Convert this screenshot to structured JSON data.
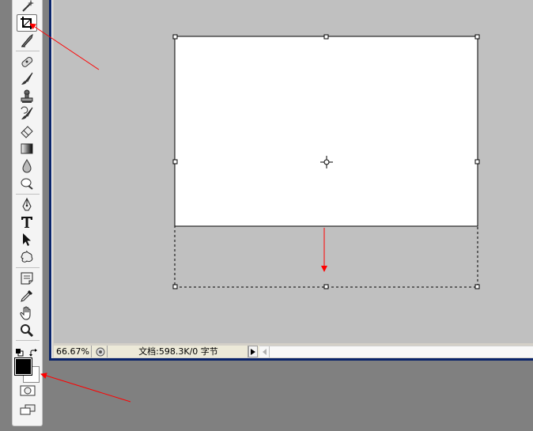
{
  "status_bar": {
    "zoom": "66.67%",
    "doc_info": "文档:598.3K/0 字节"
  },
  "toolbox": {
    "tools": [
      "magic-wand-icon",
      "crop-icon",
      "slice-icon",
      "healing-brush-icon",
      "brush-icon",
      "clone-stamp-icon",
      "history-brush-icon",
      "eraser-icon",
      "gradient-icon",
      "blur-icon",
      "dodge-icon",
      "pen-icon",
      "type-icon",
      "path-selection-icon",
      "custom-shape-icon",
      "notes-icon",
      "eyedropper-icon",
      "hand-icon",
      "zoom-icon"
    ],
    "active_tool": "crop-icon"
  },
  "colors": {
    "foreground": "#000000",
    "background": "#ffffff",
    "annotation": "#ff0000",
    "window_frame": "#0a246a"
  }
}
